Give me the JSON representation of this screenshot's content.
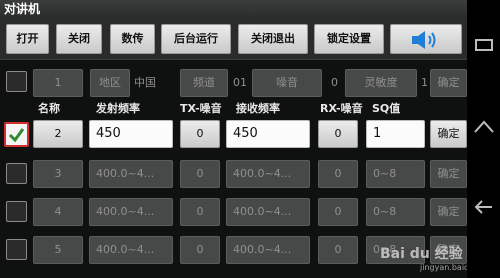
{
  "title": "对讲机",
  "toolbar": {
    "open": "打开",
    "close": "关闭",
    "transfer": "数传",
    "background": "后台运行",
    "close_exit": "关闭退出",
    "lock_settings": "锁定设置",
    "volume_icon": "speaker-icon"
  },
  "settings_row": {
    "number": "1",
    "region_label": "地区",
    "region_value": "中国",
    "channel_label": "频道",
    "channel_value": "01",
    "noise_label": "噪音",
    "noise_value": "0",
    "sensitivity_label": "灵敏度",
    "sensitivity_value": "1",
    "confirm": "确定"
  },
  "headers": {
    "name": "名称",
    "tx_freq": "发射频率",
    "tx_noise": "TX-噪音",
    "rx_freq": "接收频率",
    "rx_noise": "RX-噪音",
    "sq": "SQ值"
  },
  "channels": [
    {
      "number": "2",
      "checked": true,
      "tx_freq": "450",
      "tx_noise": "0",
      "rx_freq": "450",
      "rx_noise": "0",
      "sq": "1",
      "confirm": "确定"
    },
    {
      "number": "3",
      "checked": false,
      "tx_freq": "400.0~4...",
      "tx_noise": "0",
      "rx_freq": "400.0~4...",
      "rx_noise": "0",
      "sq": "0~8",
      "confirm": "确定"
    },
    {
      "number": "4",
      "checked": false,
      "tx_freq": "400.0~4...",
      "tx_noise": "0",
      "rx_freq": "400.0~4...",
      "rx_noise": "0",
      "sq": "0~8",
      "confirm": "确定"
    },
    {
      "number": "5",
      "checked": false,
      "tx_freq": "400.0~4...",
      "tx_noise": "0",
      "rx_freq": "400.0~4...",
      "rx_noise": "0",
      "sq": "0~8",
      "confirm": "确定"
    }
  ],
  "watermark": {
    "brand": "Bai du 经验",
    "url": "jingyan.baidu.com"
  },
  "colors": {
    "accent_check": "#d2302f",
    "speaker_blue": "#1f7fd6"
  }
}
